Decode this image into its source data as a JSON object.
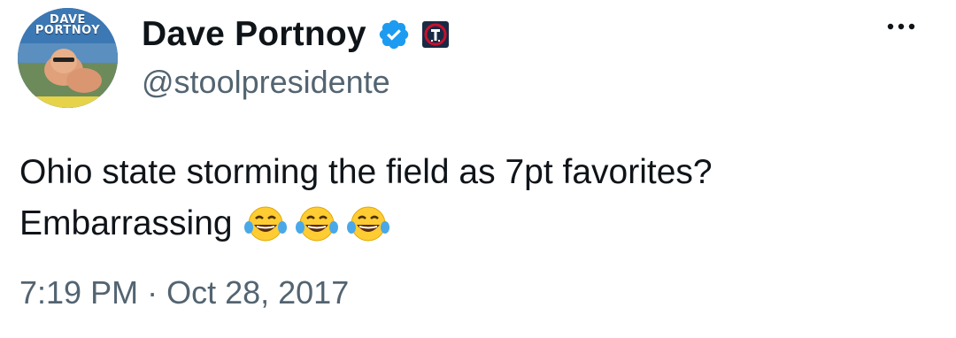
{
  "author": {
    "display_name": "Dave Portnoy",
    "handle": "@stoolpresidente",
    "avatar_logo_line1": "DAVE",
    "avatar_logo_line2": "PORTNOY",
    "verified_icon": "verified-badge-icon",
    "affiliate_icon": "barstool-affiliate-icon"
  },
  "tweet": {
    "line1": "Ohio state storming the field as 7pt favorites?",
    "line2": "Embarrassing",
    "emojis": [
      "face-with-tears-of-joy",
      "face-with-tears-of-joy",
      "face-with-tears-of-joy"
    ]
  },
  "meta": {
    "time": "7:19 PM",
    "separator": "·",
    "date": "Oct 28, 2017"
  },
  "menu": {
    "icon": "more-options-icon"
  },
  "colors": {
    "text_primary": "#0f1419",
    "text_secondary": "#536471",
    "verified_blue": "#1d9bf0",
    "background": "#ffffff"
  }
}
